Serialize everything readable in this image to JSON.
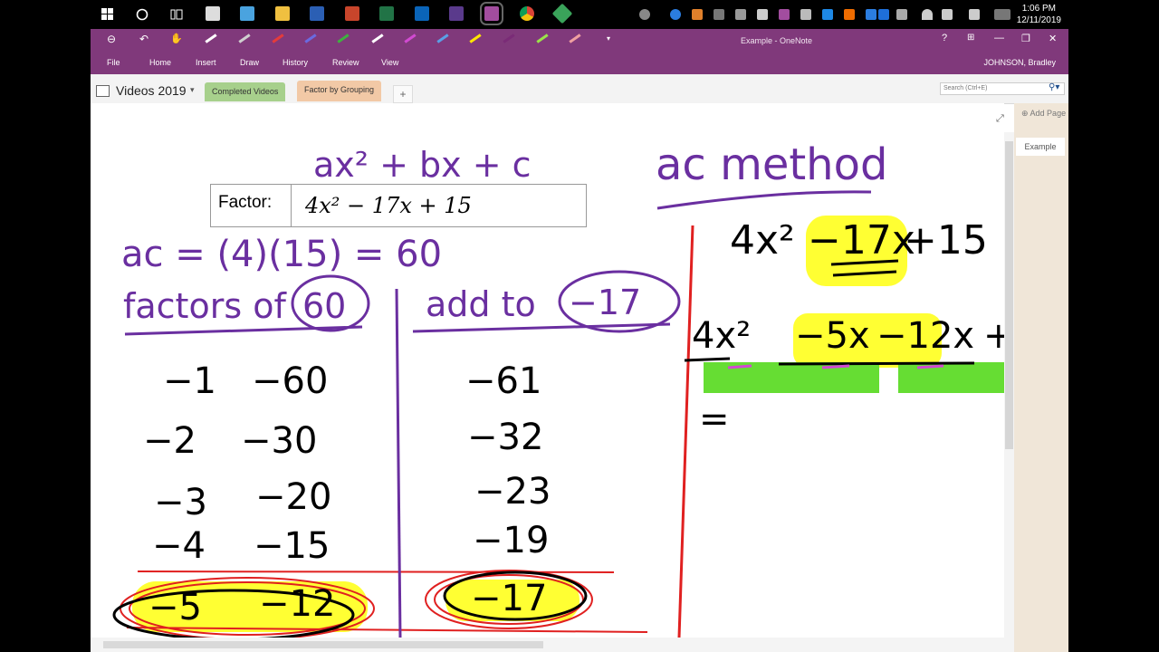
{
  "taskbar": {
    "clock_time": "1:06 PM",
    "clock_date": "12/11/2019"
  },
  "window": {
    "title": "Example - OneNote",
    "help": "?",
    "minimize": "—",
    "restore": "❐",
    "close": "✕"
  },
  "quick_access": {
    "back": "⊖",
    "undo": "↶",
    "pens_caret": "▾"
  },
  "colors": {
    "ribbon": "#80397b",
    "pen_colors": [
      "#ffffff",
      "#cfcfcf",
      "#e43b3b",
      "#6a6ae0",
      "#3fb13f",
      "#ffffff",
      "#d24ad2",
      "#5aa0e6",
      "#ffe600",
      "#7a2b77",
      "#9be34a",
      "#f0a0a0"
    ]
  },
  "menu": [
    "File",
    "Home",
    "Insert",
    "Draw",
    "History",
    "Review",
    "View"
  ],
  "user": "JOHNSON, Bradley",
  "notebook": {
    "name": "Videos 2019",
    "caret": "▾",
    "sections": [
      "Completed Videos",
      "Factor by Grouping"
    ],
    "add_section": "+"
  },
  "search": {
    "placeholder": "Search (Ctrl+E)",
    "icon": "⚲▾"
  },
  "pages": {
    "add_page": "⊕ Add Page",
    "items": [
      "Example"
    ]
  },
  "note": {
    "general_form": "ax² + bx + c",
    "factor_label": "Factor:",
    "factor_expr": "4x² − 17x + 15",
    "ac_line": "ac = (4)(15) = 60",
    "factors_heading": "factors of",
    "factors_target": "60",
    "add_heading": "add to",
    "add_target": "−17",
    "factor_pairs": [
      [
        "−1",
        "−60"
      ],
      [
        "−2",
        "−30"
      ],
      [
        "−3",
        "−20"
      ],
      [
        "−4",
        "−15"
      ],
      [
        "−5",
        "−12"
      ]
    ],
    "sums": [
      "−61",
      "−32",
      "−23",
      "−19",
      "−17"
    ],
    "method_title": "ac method",
    "rewrite_expr": [
      "4x²",
      "−17x",
      "+15"
    ],
    "split_expr": [
      "4x²",
      "−5x",
      "−12x",
      "+"
    ],
    "equals": "="
  }
}
